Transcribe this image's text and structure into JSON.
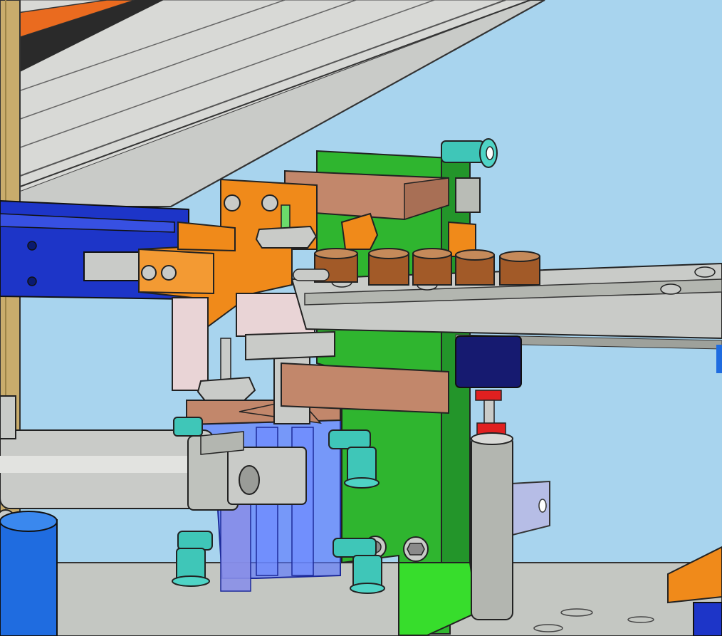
{
  "scene": {
    "description_free": true,
    "colors": {
      "background": "#a8d4ee",
      "frame_grey": "#c9cbc8",
      "rail_grey": "#b9bcb6",
      "orange": "#f08a1a",
      "green": "#2fb52f",
      "blue": "#1d35c8",
      "copper": "#b7744a",
      "bronze": "#a25a28",
      "cyan": "#3fc6b8",
      "navy": "#161a70",
      "red": "#e02020",
      "lavender": "#b6bde6",
      "translucent_blue": "#5a78ff"
    },
    "parts": [
      {
        "id": "top-extrusion",
        "icon": "aluminium-profile"
      },
      {
        "id": "vertical-post",
        "icon": "wooden-post"
      },
      {
        "id": "blue-slide-actuator",
        "icon": "linear-actuator"
      },
      {
        "id": "orange-gripper-arm",
        "icon": "gripper"
      },
      {
        "id": "green-column",
        "icon": "bracket"
      },
      {
        "id": "bushing-row",
        "icon": "bushing",
        "count": 5
      },
      {
        "id": "feed-rail",
        "icon": "rail"
      },
      {
        "id": "round-cylinder",
        "icon": "pneumatic-cylinder"
      },
      {
        "id": "guided-cylinder",
        "icon": "pneumatic-cylinder"
      },
      {
        "id": "push-fittings",
        "icon": "elbow-fitting"
      },
      {
        "id": "small-vertical-cylinder",
        "icon": "pneumatic-cylinder"
      },
      {
        "id": "base-plate",
        "icon": "plate"
      }
    ]
  }
}
